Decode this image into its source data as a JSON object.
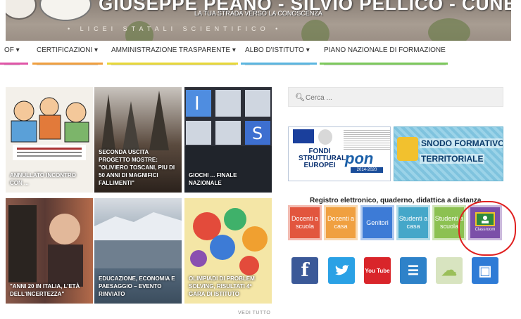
{
  "header": {
    "school_name": "GIUSEPPE PEANO - SILVIO PELLICO - CUNEO",
    "tagline": "LA TUA STRADA VERSO LA CONOSCENZA",
    "stone_text": "• LICEI   STATALI   SCIENTIFICO •"
  },
  "nav": {
    "items": [
      {
        "label": "OF"
      },
      {
        "label": "CERTIFICAZIONI"
      },
      {
        "label": "AMMINISTRAZIONE TRASPARENTE"
      },
      {
        "label": "ALBO D'ISTITUTO"
      },
      {
        "label": "PIANO NAZIONALE DI FORMAZIONE"
      }
    ],
    "line_colors": [
      "#e056a8",
      "#f0a040",
      "#e8d838",
      "#5bb6e0",
      "#7dc95c"
    ]
  },
  "tiles": [
    {
      "caption": "ANNULLATO INCONTRO CON ...",
      "bg": "#f3f0ea"
    },
    {
      "caption": "SECONDA USCITA PROGETTO MOSTRE: \"OLIVIERO TOSCANI, PIU DI 50 ANNI DI MAGNIFICI FALLIMENTI\"",
      "bg": "#4a3a30"
    },
    {
      "caption": "GIOCHI ... FINALE NAZIONALE",
      "bg": "#3d7bd6"
    },
    {
      "caption": "\"ANNI 20 IN ITALIA, L'ETÀ DELL'INCERTEZZA\"",
      "bg": "#6a4036"
    },
    {
      "caption": "EDUCAZIONE, ECONOMIA E PAESAGGIO – EVENTO RINVIATO",
      "bg": "#7a8aa0"
    },
    {
      "caption": "OLIMPIADI DI PROBLEM SOLVING, RISULTATI 4ª GARA DI ISTITUTO",
      "bg": "#f2e3a0"
    }
  ],
  "vedi_tutto": "VEDI TUTTO",
  "search": {
    "placeholder": "Cerca ..."
  },
  "banners": {
    "pon": {
      "fondi": "FONDI STRUTTURALI EUROPEI",
      "logo": "pon",
      "years": "2014-2020"
    },
    "snodo": {
      "line1": "SNODO FORMATIVO",
      "line2": "TERRITORIALE"
    }
  },
  "registro": {
    "title": "Registro elettronico, quaderno, didattica a distanza",
    "buttons": [
      {
        "label": "Docenti a scuola",
        "color": "#e2563e"
      },
      {
        "label": "Docenti a casa",
        "color": "#f0a040"
      },
      {
        "label": "Genitori",
        "color": "#3d7bd6"
      },
      {
        "label": "Studenti a casa",
        "color": "#45a7c9"
      },
      {
        "label": "Studenti a scuola",
        "color": "#8cc152"
      },
      {
        "label": "Classroom",
        "color": "#7b4fa8"
      }
    ],
    "highlight_color": "#e02020"
  },
  "social": [
    {
      "icon": "facebook-icon",
      "glyph": "f",
      "color": "#3b5998"
    },
    {
      "icon": "twitter-icon",
      "glyph": "🐦",
      "color": "#2aa1e5"
    },
    {
      "icon": "youtube-icon",
      "glyph": "You Tube",
      "color": "#d9252a"
    },
    {
      "icon": "document-icon",
      "glyph": "☰",
      "color": "#2e82c9"
    },
    {
      "icon": "cloud-icon",
      "glyph": "☁",
      "color": "#d8e4c0"
    },
    {
      "icon": "presentation-icon",
      "glyph": "▣",
      "color": "#2e7bd6"
    }
  ]
}
